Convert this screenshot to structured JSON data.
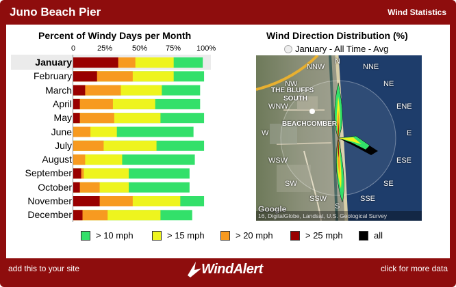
{
  "header": {
    "title": "Juno Beach Pier",
    "right_label": "Wind Statistics"
  },
  "footer": {
    "left_link": "add this to your site",
    "logo_text": "WindAlert",
    "right_link": "click for more data"
  },
  "colors": {
    "frame": "#8e0d0d",
    "gt10": "#33e06a",
    "gt15": "#eef41e",
    "gt20": "#f79a20",
    "gt25": "#990000",
    "all": "#000000"
  },
  "monthly_chart": {
    "title": "Percent of Windy Days per Month",
    "axis_ticks": [
      "0",
      "25%",
      "50%",
      "75%",
      "100%"
    ],
    "selected": "January"
  },
  "chart_data": {
    "type": "bar",
    "orientation": "horizontal",
    "stacking": "overlay",
    "title": "Percent of Windy Days per Month",
    "categories": [
      "January",
      "February",
      "March",
      "April",
      "May",
      "June",
      "July",
      "August",
      "September",
      "October",
      "November",
      "December"
    ],
    "xlim": [
      0,
      100
    ],
    "series": [
      {
        "name": "> 10 mph",
        "color": "#33e06a",
        "values": [
          98,
          99,
          96,
          96,
          99,
          91,
          99,
          92,
          88,
          88,
          99,
          90
        ]
      },
      {
        "name": "> 15 mph",
        "color": "#eef41e",
        "values": [
          76,
          76,
          67,
          62,
          66,
          33,
          63,
          37,
          42,
          42,
          81,
          66
        ]
      },
      {
        "name": "> 20 mph",
        "color": "#f79a20",
        "values": [
          47,
          45,
          36,
          30,
          31,
          13,
          23,
          9,
          8,
          20,
          45,
          26
        ]
      },
      {
        "name": "> 25 mph",
        "color": "#990000",
        "values": [
          34,
          18,
          9,
          5,
          5,
          0,
          0,
          0,
          6,
          5,
          20,
          7
        ]
      },
      {
        "name": "all",
        "color": "#000000",
        "values": []
      }
    ]
  },
  "legend": [
    {
      "label": "> 10 mph",
      "color": "#33e06a"
    },
    {
      "label": "> 15 mph",
      "color": "#eef41e"
    },
    {
      "label": "> 20 mph",
      "color": "#f79a20"
    },
    {
      "label": "> 25 mph",
      "color": "#990000"
    },
    {
      "label": "all",
      "color": "#000000"
    }
  ],
  "direction_panel": {
    "title": "Wind Direction Distribution (%)",
    "option_label": "January - All Time - Avg",
    "compass": [
      "N",
      "NNE",
      "NE",
      "ENE",
      "E",
      "ESE",
      "SE",
      "SSE",
      "S",
      "SSW",
      "SW",
      "WSW",
      "W",
      "WNW",
      "NW",
      "NNW"
    ],
    "map_labels": [
      "THE BLUFFS",
      "SOUTH",
      "BEACHCOMBER"
    ],
    "copyright": "16, DigitalGlobe, Landsat, U.S. Geological Survey",
    "google": "Google"
  }
}
